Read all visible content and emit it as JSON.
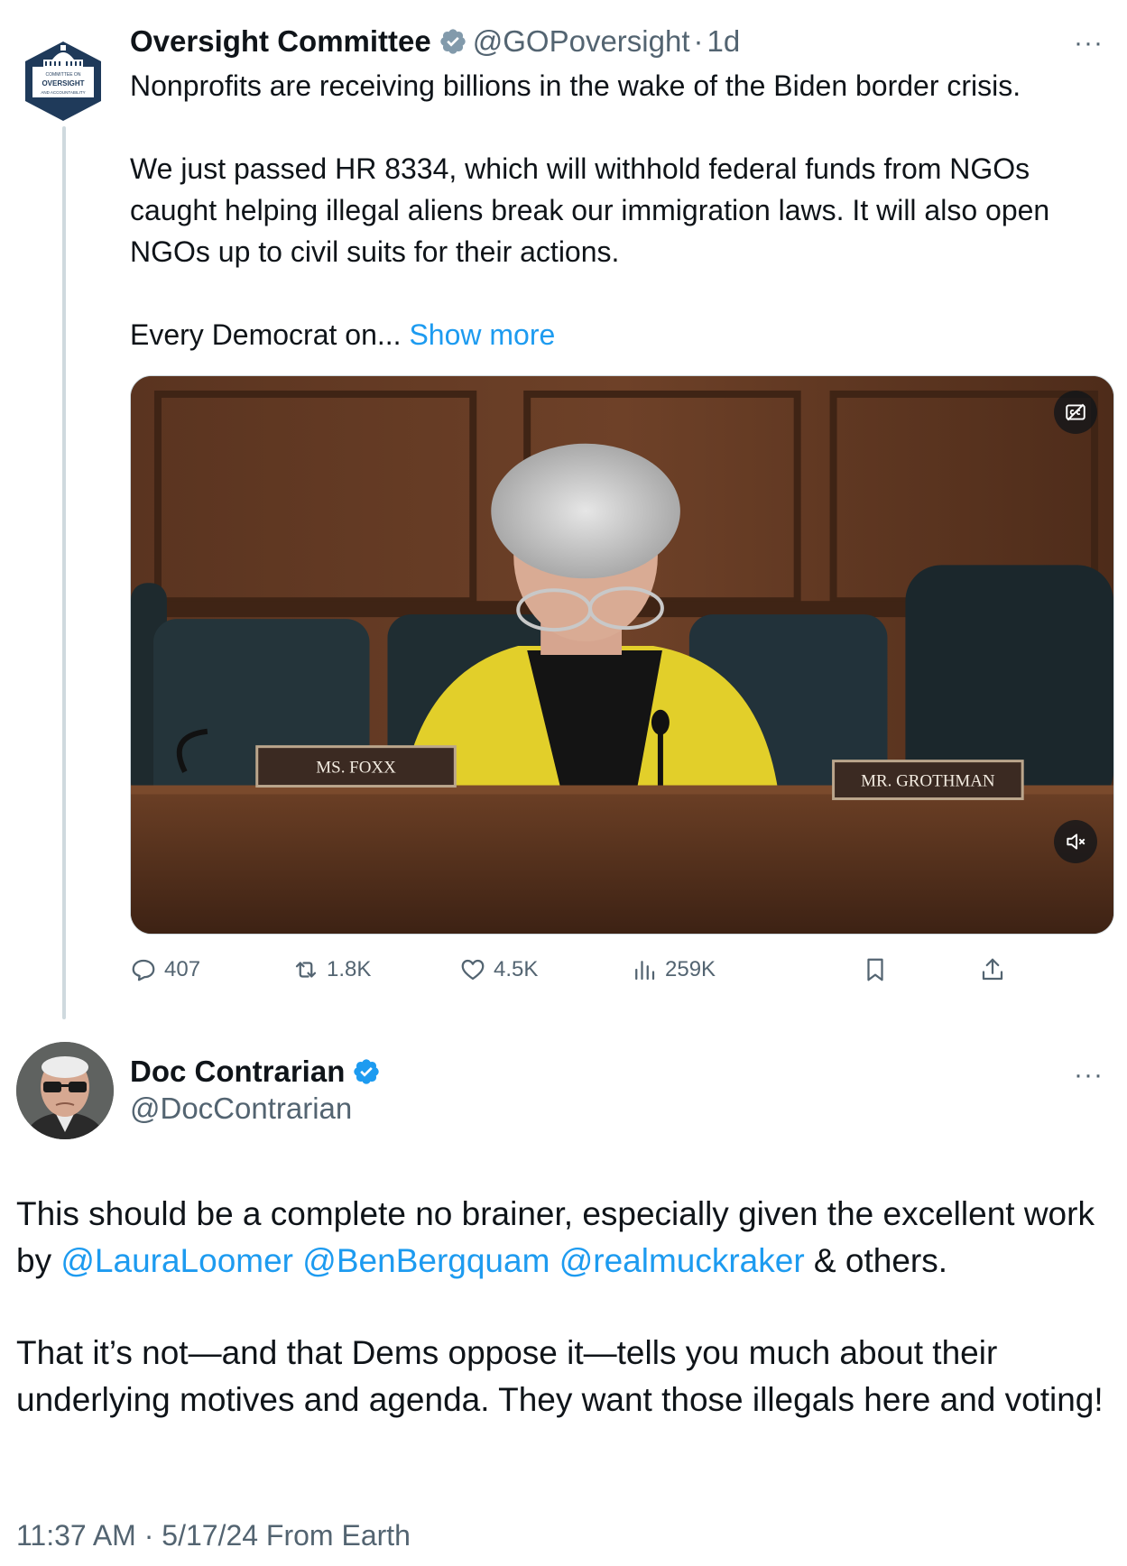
{
  "parent_tweet": {
    "author_name": "Oversight Committee",
    "handle": "@GOPoversight",
    "separator": "·",
    "age": "1d",
    "more": "···",
    "avatar_lines": [
      "COMMITTEE ON",
      "OVERSIGHT",
      "AND ACCOUNTABILITY"
    ],
    "paragraphs": [
      "Nonprofits are receiving billions in the wake of the Biden border crisis.",
      "We just passed HR 8334, which will withhold federal funds from NGOs caught helping illegal aliens break our immigration laws. It will also open NGOs up to civil suits for their actions."
    ],
    "truncated_text": "Every Democrat on... ",
    "show_more": "Show more",
    "media": {
      "nameplate_left": "MS. FOXX",
      "nameplate_right": "MR. GROTHMAN",
      "captions_icon": "captions-off-icon",
      "mute_icon": "muted-speaker-icon"
    },
    "stats": {
      "replies": "407",
      "reposts": "1.8K",
      "likes": "4.5K",
      "views": "259K"
    }
  },
  "reply_tweet": {
    "author_name": "Doc Contrarian",
    "handle": "@DocContrarian",
    "more": "···",
    "paragraph1_lead": "This should be a complete no brainer, especially given the excellent work by ",
    "mentions": [
      "@LauraLoomer",
      "@BenBergquam",
      "@realmuckraker"
    ],
    "paragraph1_tail": " & others.",
    "paragraph2": "That it’s not—and that Dems oppose it—tells you much about their underlying motives and agenda. They want those illegals here and voting!",
    "meta": "11:37 AM · 5/17/24 From Earth"
  },
  "colors": {
    "link": "#1d9bf0",
    "muted": "#536471",
    "verified_blue": "#1d9bf0",
    "verified_gray": "#829aab",
    "org_navy": "#1f3a5a"
  }
}
